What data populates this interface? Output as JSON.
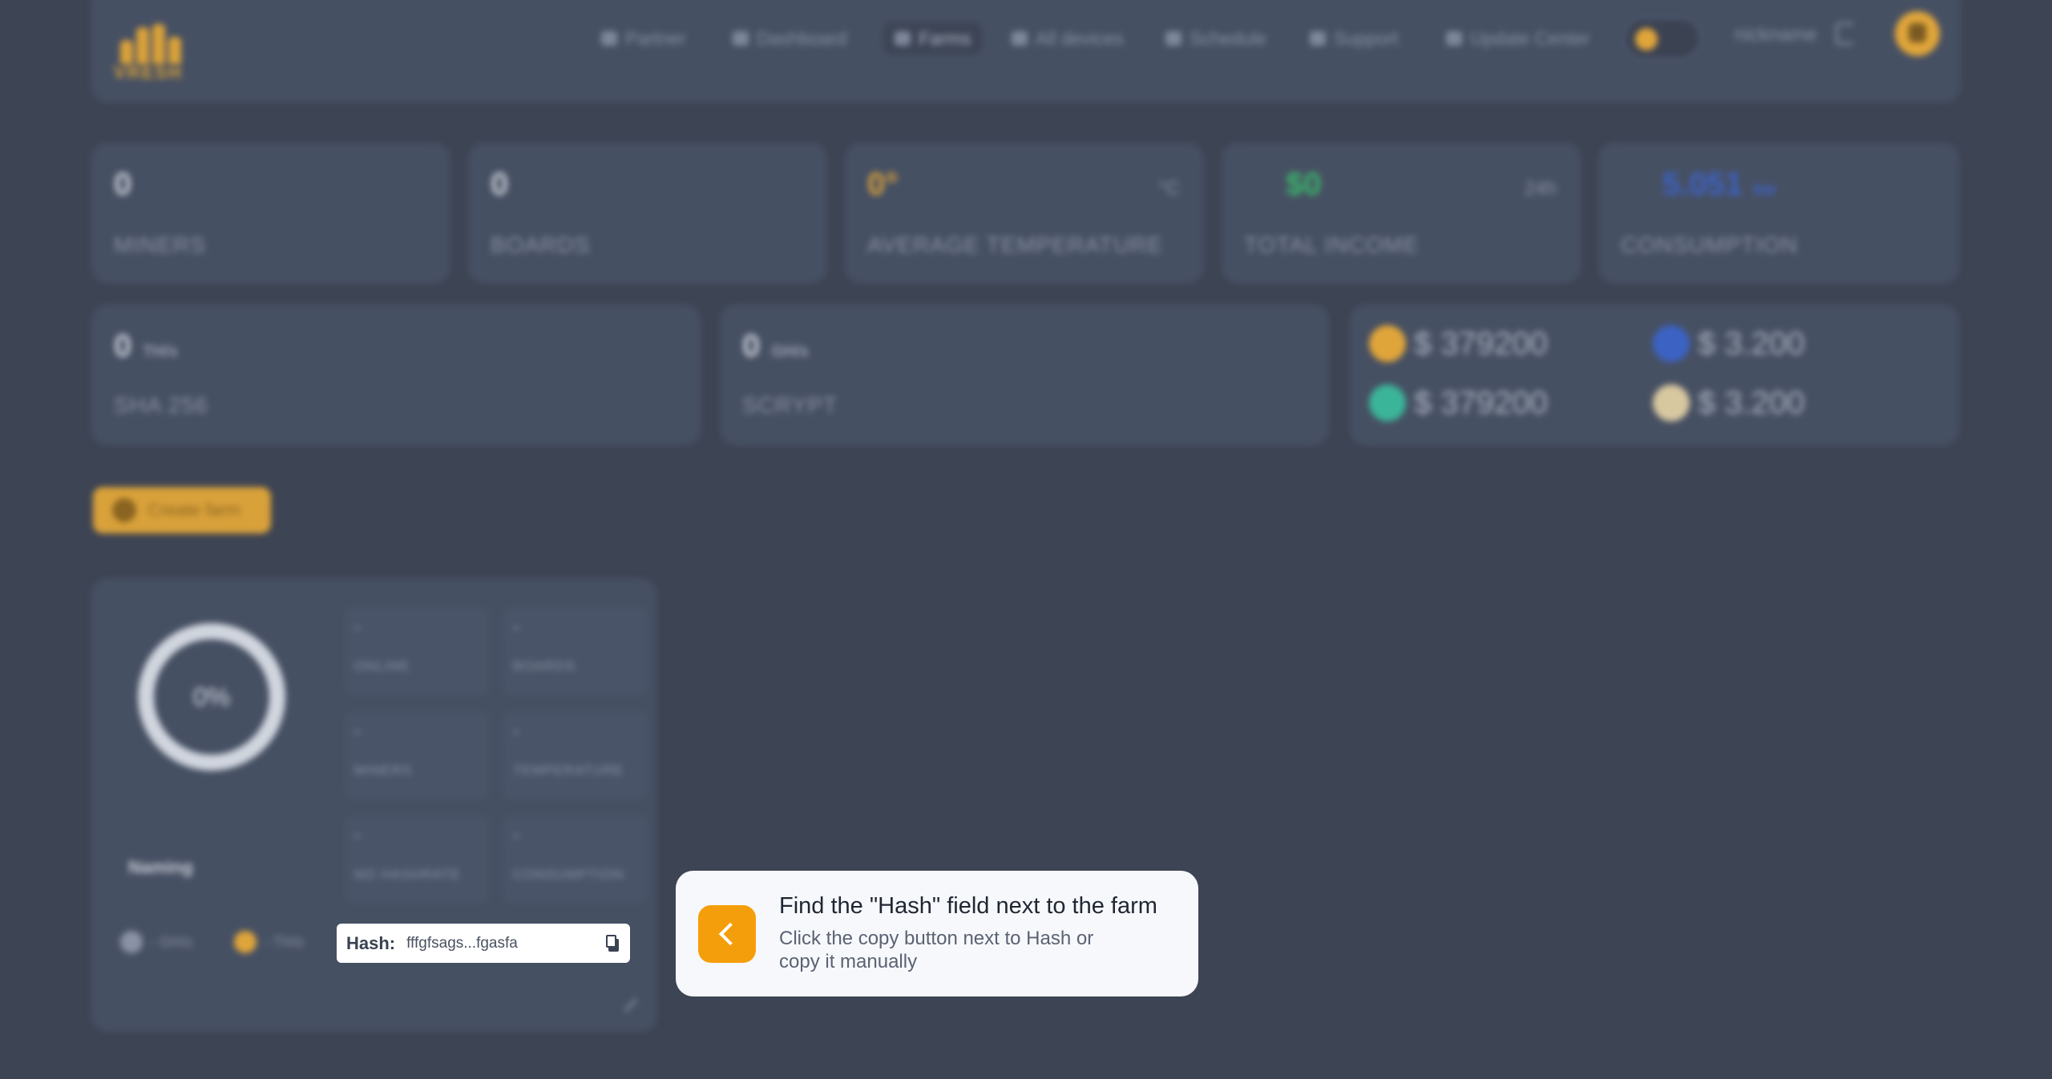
{
  "header": {
    "logo_text": "VRESH",
    "nav": [
      {
        "label": "Partner",
        "icon": "handshake-icon"
      },
      {
        "label": "Dashboard",
        "icon": "dashboard-icon"
      },
      {
        "label": "Farms",
        "icon": "share-nodes-icon",
        "active": true
      },
      {
        "label": "All devices",
        "icon": "bolt-icon"
      },
      {
        "label": "Schedule",
        "icon": "calendar-icon"
      },
      {
        "label": "Support",
        "icon": "chat-icon"
      },
      {
        "label": "Update Center",
        "icon": "gear-icon"
      }
    ],
    "nickname": "nickname"
  },
  "stats": [
    {
      "value": "0",
      "label": "MINERS"
    },
    {
      "value": "0",
      "label": "BOARDS"
    },
    {
      "value": "0°",
      "label": "AVERAGE TEMPERATURE",
      "unit": "°C"
    },
    {
      "value": "$0",
      "label": "TOTAL INCOME",
      "unit": "24h"
    },
    {
      "value": "5.051",
      "label": "CONSUMPTION",
      "unit": "kw"
    }
  ],
  "hashrates": [
    {
      "value": "0",
      "unit": "TH/s",
      "label": "SHA 256"
    },
    {
      "value": "0",
      "unit": "GH/s",
      "label": "SCRYPT"
    }
  ],
  "prices": [
    {
      "value": "$ 379200",
      "color": "#e0a53a"
    },
    {
      "value": "$ 3.200",
      "color": "#3c62c4"
    },
    {
      "value": "$ 379200",
      "color": "#3bb59a"
    },
    {
      "value": "$ 3.200",
      "color": "#d8c8a0"
    }
  ],
  "create_farm_label": "Create farm",
  "farm": {
    "percent": "0%",
    "name": "Naming",
    "stats": [
      {
        "value": "-",
        "label": "ONLINE"
      },
      {
        "value": "-",
        "label": "BOARDS"
      },
      {
        "value": "-",
        "label": "MINERS"
      },
      {
        "value": "-",
        "label": "TEMPERATURE"
      },
      {
        "value": "-",
        "label": "NO HASHRATE"
      },
      {
        "value": "-",
        "label": "CONSUMPTION"
      }
    ],
    "coins": [
      {
        "text": "- GH/s",
        "color": "#8a93a5"
      },
      {
        "text": "- TH/s",
        "color": "#e0a53a"
      }
    ],
    "hash_label": "Hash:",
    "hash_value": "fffgfsags...fgasfa"
  },
  "tooltip": {
    "title": "Find the \"Hash\" field next to the farm",
    "text": "Click the copy button next to Hash or copy it manually"
  },
  "colors": {
    "accent": "#f59e0b",
    "background": "#3d4454"
  }
}
